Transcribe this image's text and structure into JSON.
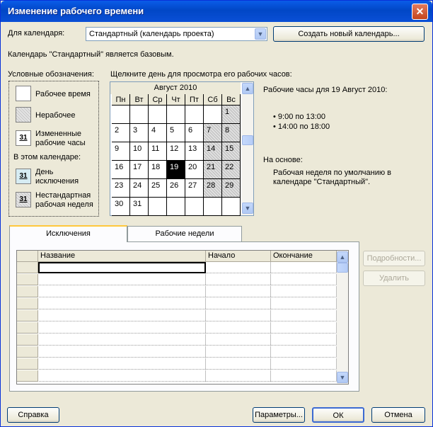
{
  "window": {
    "title": "Изменение рабочего времени",
    "close": "✕"
  },
  "calendar_for": {
    "label": "Для календаря:",
    "selected": "Стандартный (календарь проекта)"
  },
  "buttons": {
    "new_calendar": "Создать новый календарь...",
    "details": "Подробности...",
    "delete": "Удалить",
    "help": "Справка",
    "params": "Параметры...",
    "ok": "ОК",
    "cancel": "Отмена"
  },
  "base_info": "Календарь \"Стандартный\" является базовым.",
  "legend": {
    "title": "Условные обозначения:",
    "working": "Рабочее время",
    "nonworking": "Нерабочее",
    "changed_line1": "Измененные",
    "changed_line2": "рабочие часы",
    "in_calendar": "В этом календаре:",
    "exception_line1": "День",
    "exception_line2": "исключения",
    "nonstd_line1": "Нестандартная",
    "nonstd_line2": "рабочая неделя",
    "icon_number": "31"
  },
  "calendar": {
    "hint": "Щелкните день для просмотра его рабочих часов:",
    "month": "Август 2010",
    "weekdays": [
      "Пн",
      "Вт",
      "Ср",
      "Чт",
      "Пт",
      "Сб",
      "Вс"
    ],
    "selected_day": 19,
    "weeks": [
      [
        "",
        "",
        "",
        "",
        "",
        "",
        "1"
      ],
      [
        "2",
        "3",
        "4",
        "5",
        "6",
        "7",
        "8"
      ],
      [
        "9",
        "10",
        "11",
        "12",
        "13",
        "14",
        "15"
      ],
      [
        "16",
        "17",
        "18",
        "19",
        "20",
        "21",
        "22"
      ],
      [
        "23",
        "24",
        "25",
        "26",
        "27",
        "28",
        "29"
      ],
      [
        "30",
        "31",
        "",
        "",
        "",
        "",
        ""
      ]
    ]
  },
  "working_hours": {
    "title": "Рабочие часы для 19 Август 2010:",
    "items": [
      "9:00 по 13:00",
      "14:00 по 18:00"
    ],
    "based_on_label": "На основе:",
    "based_on_line1": "Рабочая неделя по умолчанию в",
    "based_on_line2": "календаре \"Стандартный\"."
  },
  "tabs": [
    {
      "label": "Исключения",
      "active": true
    },
    {
      "label": "Рабочие недели",
      "active": false
    }
  ],
  "table": {
    "columns": [
      "Название",
      "Начало",
      "Окончание"
    ]
  }
}
